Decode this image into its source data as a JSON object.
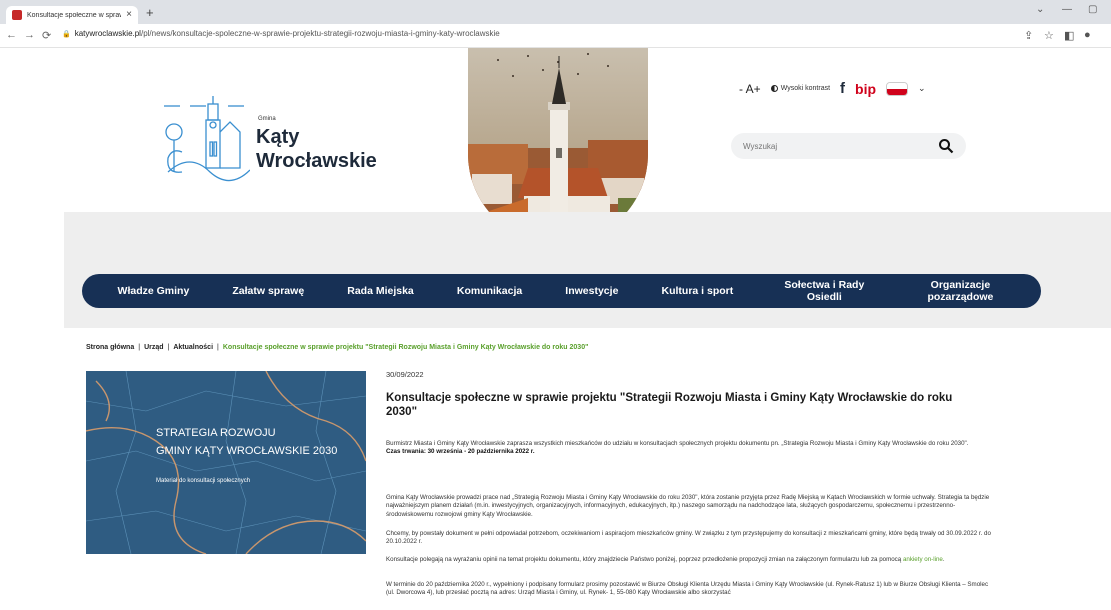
{
  "browser": {
    "tab_title": "Konsultacje społeczne w sprawie",
    "url_domain": "katywroclawskie.pl",
    "url_path": "/pl/news/konsultacje-spoleczne-w-sprawie-projektu-strategii-rozwoju-miasta-i-gminy-katy-wroclawskie"
  },
  "header": {
    "logo_small": "Gmina",
    "logo_line1": "Kąty",
    "logo_line2": "Wrocławskie",
    "font_size_control": "- A+",
    "contrast_label": "Wysoki kontrast",
    "bip_label": "bip",
    "search_placeholder": "Wyszukaj"
  },
  "nav": {
    "items": [
      {
        "label": "Władze Gminy"
      },
      {
        "label": "Załatw sprawę"
      },
      {
        "label": "Rada Miejska"
      },
      {
        "label": "Komunikacja"
      },
      {
        "label": "Inwestycje"
      },
      {
        "label": "Kultura i sport"
      },
      {
        "label": "Sołectwa i Rady Osiedli"
      },
      {
        "label": "Organizacje pozarządowe"
      }
    ]
  },
  "breadcrumb": {
    "home": "Strona główna",
    "office": "Urząd",
    "news": "Aktualności",
    "current": "Konsultacje społeczne w sprawie projektu \"Strategii Rozwoju Miasta i Gminy Kąty Wrocławskie do roku 2030\""
  },
  "article": {
    "image_line1": "STRATEGIA ROZWOJU",
    "image_line2": "GMINY KĄTY WROCŁAWSKIE 2030",
    "image_line3": "Materiał do konsultacji społecznych",
    "date": "30/09/2022",
    "title": "Konsultacje społeczne w sprawie projektu \"Strategii Rozwoju Miasta i Gminy Kąty Wrocławskie do roku 2030\"",
    "p1": "Burmistrz Miasta i Gminy Kąty Wrocławskie zaprasza wszystkich mieszkańców do udziału w konsultacjach społecznych projektu dokumentu pn. „Strategia Rozwoju Miasta i Gminy Kąty Wrocławskie do roku 2030\".",
    "p1_bold": "Czas trwania: 30 września - 20 października 2022 r.",
    "p2": "Gmina Kąty Wrocławskie prowadzi prace nad „Strategią Rozwoju Miasta i Gminy Kąty Wrocławskie do roku 2030\", która zostanie przyjęta przez Radę Miejską w Kątach Wrocławskich w formie uchwały. Strategia ta będzie najważniejszym planem działań (m.in. inwestycyjnych, organizacyjnych, informacyjnych, edukacyjnych, itp.) naszego samorządu na nadchodzące lata, służących gospodarczemu, społecznemu i przestrzenno-środowiskowemu rozwojowi gminy Kąty Wrocławskie.",
    "p3": "Chcemy, by powstały dokument w pełni odpowiadał potrzebom, oczekiwaniom i aspiracjom mieszkańców gminy. W związku z tym przystępujemy do konsultacji z mieszkańcami gminy, które będą trwały od 30.09.2022 r. do 20.10.2022 r.",
    "p4_start": "Konsultacje polegają na wyrażaniu opinii na temat projektu dokumentu, który znajdziecie Państwo poniżej, poprzez przedłożenie propozycji zmian na załączonym formularzu lub za pomocą",
    "p4_link": "ankiety on-line",
    "p4_end": ".",
    "p5": "W terminie do 20 października 2020 r., wypełniony i podpisany formularz prosimy pozostawić w Biurze Obsługi Klienta Urzędu Miasta i Gminy Kąty Wrocławskie (ul. Rynek-Ratusz 1) lub w Biurze Obsługi Klienta – Smolec (ul. Dworcowa 4), lub przesłać pocztą na adres: Urząd Miasta i Gminy, ul. Rynek- 1, 55-080 Kąty Wrocławskie albo skorzystać"
  },
  "colors": {
    "nav_bg": "#173055",
    "accent_green": "#5aa02c",
    "bip_red": "#d0021b"
  }
}
